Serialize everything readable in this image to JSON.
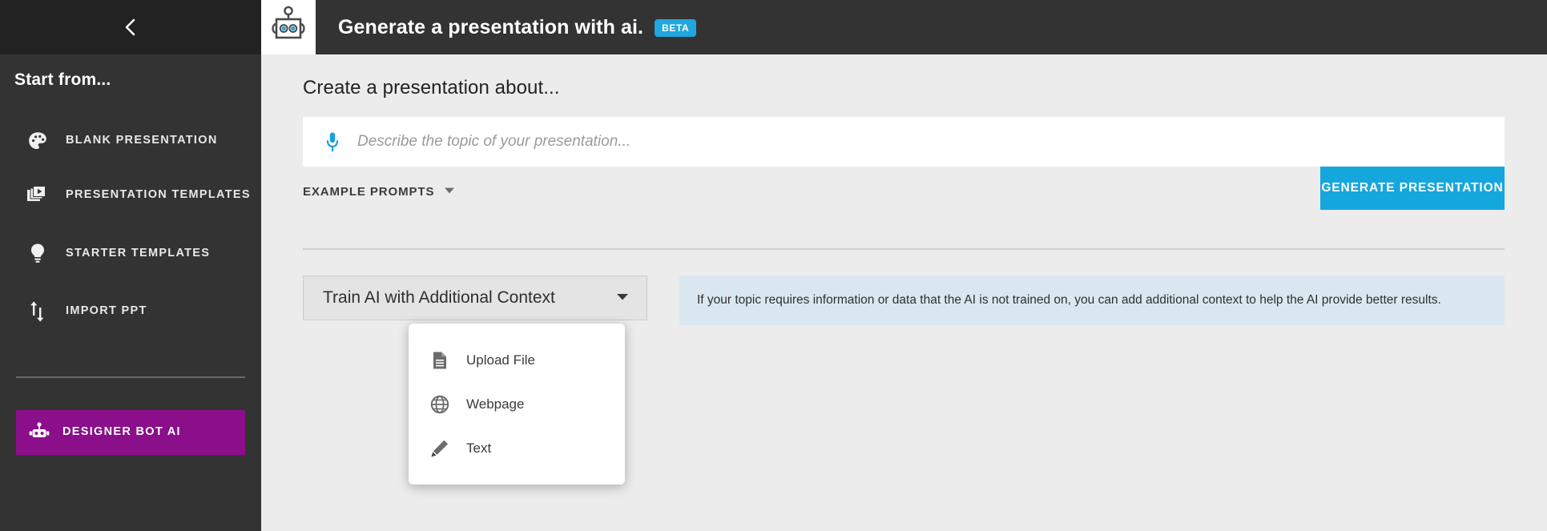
{
  "sidebar": {
    "collapse_icon": "chevron-left-icon",
    "heading": "Start from...",
    "items": [
      {
        "label": "BLANK PRESENTATION",
        "icon": "palette-icon"
      },
      {
        "label": "PRESENTATION TEMPLATES",
        "icon": "slides-icon"
      },
      {
        "label": "STARTER TEMPLATES",
        "icon": "lightbulb-icon"
      },
      {
        "label": "IMPORT PPT",
        "icon": "import-arrows-icon"
      }
    ],
    "designer_bot": {
      "label": "DESIGNER BOT AI",
      "icon": "robot-icon",
      "color": "#8B0E8B"
    }
  },
  "header": {
    "logo_icon": "robot-logo-icon",
    "title": "Generate a presentation with ai.",
    "badge": "BETA",
    "badge_color": "#21A7DE",
    "background": "#333333"
  },
  "main": {
    "heading": "Create a presentation about...",
    "topic_input": {
      "value": "",
      "placeholder": "Describe the topic of your presentation...",
      "icon": "microphone-icon",
      "icon_color": "#1AA0DC"
    },
    "example_prompts": {
      "label": "EXAMPLE PROMPTS",
      "icon": "chevron-down-icon"
    },
    "generate_button": {
      "label": "GENERATE PRESENTATION",
      "color": "#16A6DE"
    },
    "train_dropdown": {
      "label": "Train AI with Additional Context",
      "icon": "chevron-down-icon"
    },
    "info_panel": {
      "text": "If your topic requires information or data that the AI is not trained on, you can add additional context to help the AI provide better results.",
      "color": "#D9E8F0"
    },
    "context_menu": [
      {
        "label": "Upload File",
        "icon": "document-icon"
      },
      {
        "label": "Webpage",
        "icon": "globe-icon"
      },
      {
        "label": "Text",
        "icon": "pencil-icon"
      }
    ]
  }
}
